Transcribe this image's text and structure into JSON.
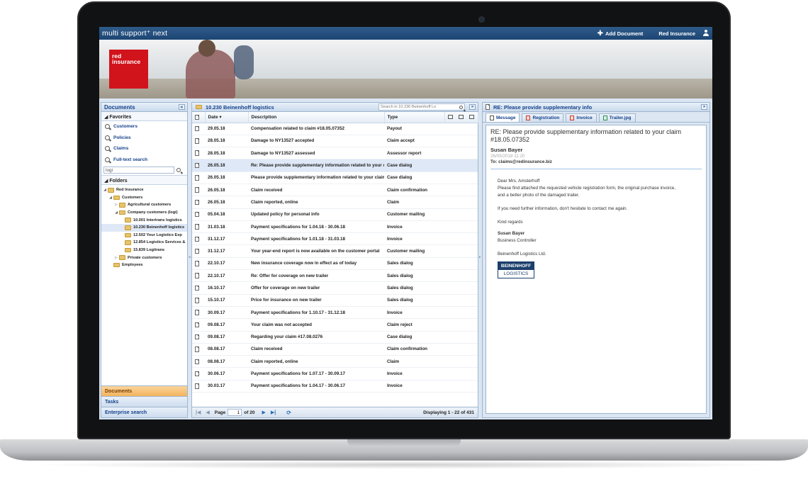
{
  "app": {
    "brand": "multi support⁺ next",
    "add_document": "Add Document",
    "user_name": "Red Insurance",
    "logo_text": "red insurance"
  },
  "left": {
    "title": "Documents",
    "favorites_label": "Favorites",
    "nav": [
      "Customers",
      "Policies",
      "Claims",
      "Full-text search"
    ],
    "search_value": "logi",
    "folders_label": "Folders",
    "tree": [
      {
        "label": "Red Insurance",
        "level": 0,
        "open": true
      },
      {
        "label": "Customers",
        "level": 1,
        "open": true
      },
      {
        "label": "Agricultural customers",
        "level": 2,
        "open": false
      },
      {
        "label": "Company customers (logi)",
        "level": 2,
        "open": true
      },
      {
        "label": "10.001 Intertrans logistics",
        "level": 3
      },
      {
        "label": "10.230 Beinenhoff logistics",
        "level": 3,
        "selected": true
      },
      {
        "label": "12.502 Your Logistics Exp",
        "level": 3
      },
      {
        "label": "12.854 Logistics Services &",
        "level": 3
      },
      {
        "label": "15.839 Logitrans",
        "level": 3
      },
      {
        "label": "Private customers",
        "level": 2,
        "open": false
      },
      {
        "label": "Employees",
        "level": 1
      }
    ],
    "accordion": [
      "Documents",
      "Tasks",
      "Enterprise search"
    ]
  },
  "center": {
    "title": "10.230  Beinenhoff logistics",
    "search_placeholder": "Search in 10.230 Beinenhoff Lo",
    "columns": {
      "date": "Date ▾",
      "description": "Description",
      "type": "Type"
    },
    "rows": [
      {
        "date": "29.05.18",
        "description": "Compensation related to claim #18.05.07352",
        "type": "Payout"
      },
      {
        "date": "28.05.18",
        "description": "Damage to NY13527 accepted",
        "type": "Claim accept"
      },
      {
        "date": "28.05.18",
        "description": "Damage to NY13527 assessed",
        "type": "Assessor report"
      },
      {
        "date": "26.05.18",
        "description": "Re: Please provide supplementary information related to your claim",
        "type": "Case dialog",
        "selected": true
      },
      {
        "date": "26.05.18",
        "description": "Please provide supplementary information related to your claim",
        "type": "Case dialog"
      },
      {
        "date": "26.05.18",
        "description": "Claim received",
        "type": "Claim confirmation"
      },
      {
        "date": "26.05.18",
        "description": "Claim reported, online",
        "type": "Claim"
      },
      {
        "date": "05.04.18",
        "description": "Updated policy for personal info",
        "type": "Customer mailing"
      },
      {
        "date": "31.03.18",
        "description": "Payment specifications for 1.04.18 - 30.06.18",
        "type": "Invoice"
      },
      {
        "date": "31.12.17",
        "description": "Payment specifications for 1.01.18 - 31.03.18",
        "type": "Invoice"
      },
      {
        "date": "31.12.17",
        "description": "Your year-end report is now available on the customer portal",
        "type": "Customer mailing"
      },
      {
        "date": "22.10.17",
        "description": "New insurance coverage now in effect as of today",
        "type": "Sales dialog"
      },
      {
        "date": "22.10.17",
        "description": "Re: Offer for coverage on new trailer",
        "type": "Sales dialog"
      },
      {
        "date": "16.10.17",
        "description": "Offer for coverage on new trailer",
        "type": "Sales dialog"
      },
      {
        "date": "15.10.17",
        "description": "Price for insurance on new trailer",
        "type": "Sales dialog"
      },
      {
        "date": "30.09.17",
        "description": "Payment specifications for 1.10.17 - 31.12.18",
        "type": "Invoice"
      },
      {
        "date": "09.08.17",
        "description": "Your claim was not accepted",
        "type": "Claim reject"
      },
      {
        "date": "09.08.17",
        "description": "Regarding your claim #17.08.0276",
        "type": "Case dialog"
      },
      {
        "date": "08.08.17",
        "description": "Claim received",
        "type": "Claim confirmation"
      },
      {
        "date": "08.08.17",
        "description": "Claim reported, online",
        "type": "Claim"
      },
      {
        "date": "30.06.17",
        "description": "Payment specifications for 1.07.17 - 30.09.17",
        "type": "Invoice"
      },
      {
        "date": "30.03.17",
        "description": "Payment specifications for 1.04.17 - 30.06.17",
        "type": "Invoice"
      }
    ],
    "pager": {
      "page_label": "Page",
      "page_value": "1",
      "of_label": "of 20",
      "displaying": "Displaying 1 - 22 of 431"
    }
  },
  "right": {
    "title": "RE: Please provide supplementary info",
    "tabs": [
      {
        "label": "Message",
        "icon": "msg"
      },
      {
        "label": "Registration",
        "icon": "red"
      },
      {
        "label": "Invoice",
        "icon": "red"
      },
      {
        "label": "Trailer.jpg",
        "icon": "green"
      }
    ],
    "subject": "RE: Please provide supplementary information related to your claim #18.05.07352",
    "sender": "Susan Bayer",
    "date": "26/05/2018 11:20",
    "to": "To: claims@redinsurance.biz",
    "greeting": "Dear Mrs. Amsterhoff",
    "body1": "Please find attached the requested vehicle registration form, the original purchase invoice,",
    "body2": "and a better photo of the damaged trailer.",
    "body3": "If you need further information, don't hesitate to contact me again.",
    "regards": "Kind regards",
    "sig_name": "Susan Bayer",
    "sig_title": "Business Controller",
    "company": "Beinenhoff Logistics Ltd.",
    "logo_top": "BEINENHOFF",
    "logo_bottom": "LOGISTICS"
  }
}
